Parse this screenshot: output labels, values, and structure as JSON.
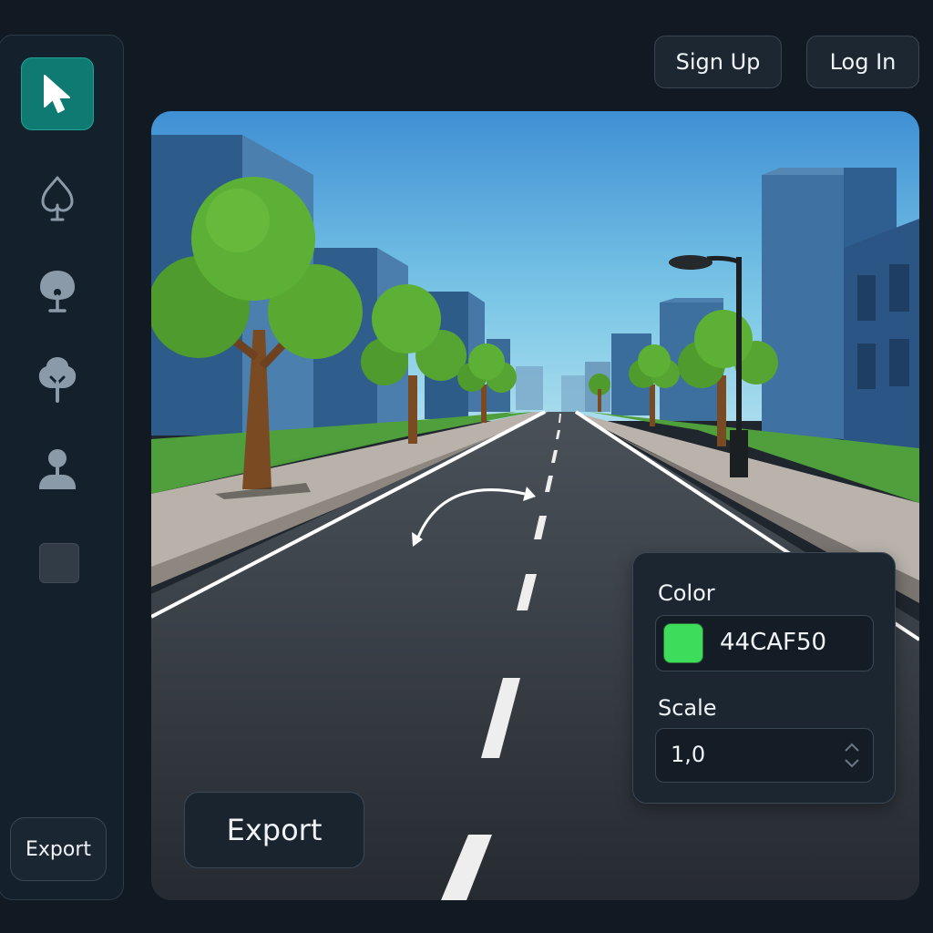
{
  "header": {
    "signup_label": "Sign Up",
    "login_label": "Log In"
  },
  "toolbar": {
    "tools": [
      {
        "icon": "cursor-icon",
        "active": true
      },
      {
        "icon": "spade-tree-icon",
        "active": false
      },
      {
        "icon": "round-tree-icon",
        "active": false
      },
      {
        "icon": "deciduous-tree-icon",
        "active": false
      },
      {
        "icon": "person-icon",
        "active": false
      },
      {
        "icon": "square-shape-icon",
        "active": false
      }
    ],
    "export_label": "Export"
  },
  "canvas": {
    "export_label": "Export",
    "rotate_gizmo_icon": "rotate-arrows-icon"
  },
  "properties": {
    "color_label": "Color",
    "color_value": "44CAF50",
    "color_swatch": "#3ddc5a",
    "scale_label": "Scale",
    "scale_value": "1,0"
  },
  "colors": {
    "accent": "#0f7a72",
    "background": "#111a23",
    "panel": "#1c2631"
  }
}
